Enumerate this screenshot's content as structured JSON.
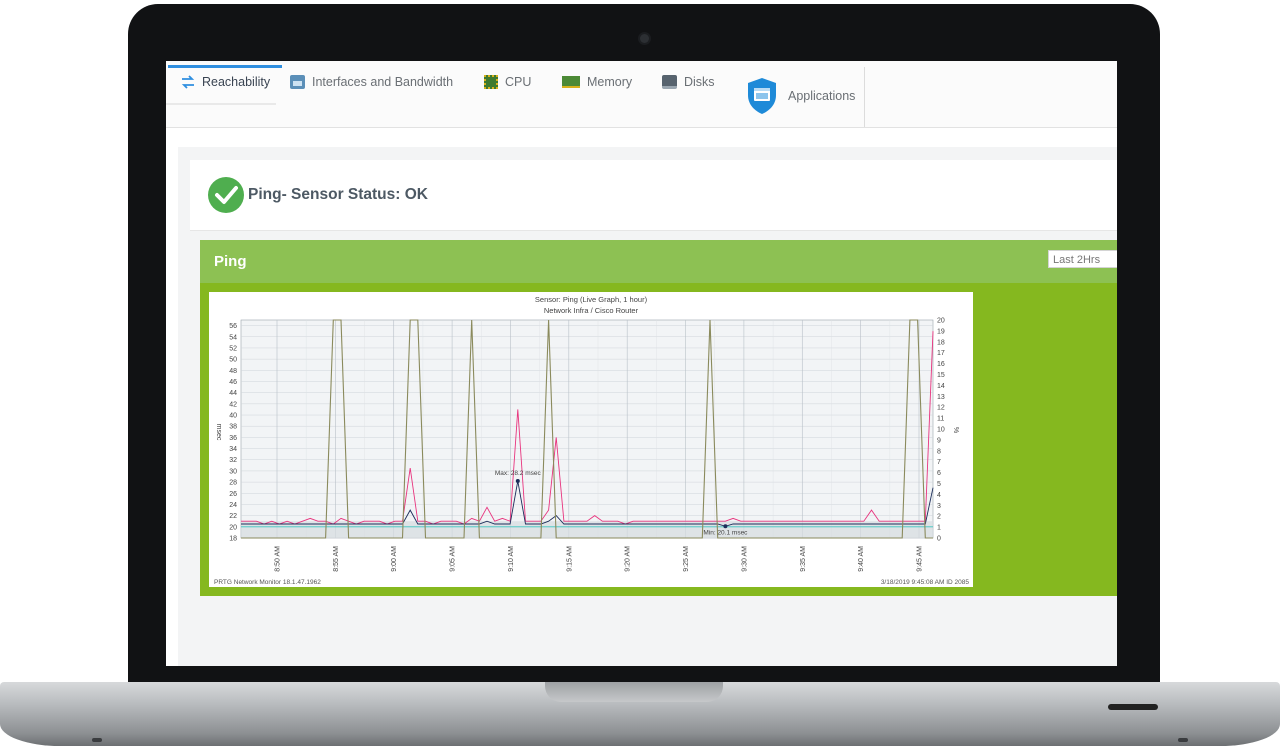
{
  "tabs": [
    {
      "label": "Reachability",
      "icon": "arrows-exchange-icon",
      "active": true
    },
    {
      "label": "Interfaces and Bandwidth",
      "icon": "network-interface-icon",
      "active": false
    },
    {
      "label": "CPU",
      "icon": "cpu-chip-icon",
      "active": false
    },
    {
      "label": "Memory",
      "icon": "memory-module-icon",
      "active": false
    },
    {
      "label": "Disks",
      "icon": "disk-drive-icon",
      "active": false
    },
    {
      "label": "Applications",
      "icon": "shield-window-icon",
      "active": false
    }
  ],
  "status": {
    "text": "Ping- Sensor Status: OK",
    "icon": "checkmark-circle-icon",
    "color": "#4fae4f"
  },
  "panel": {
    "title": "Ping",
    "range_label": "Last 2Hrs",
    "header_color": "#8dc153",
    "body_color": "#85b81f"
  },
  "chart_data": {
    "type": "line",
    "title": "Sensor: Ping (Live Graph, 1 hour)",
    "subtitle": "Network Infra / Cisco Router",
    "ylabel": "msec",
    "y2label": "%",
    "ylim": [
      18,
      57
    ],
    "y2lim": [
      0,
      20
    ],
    "yticks": [
      18,
      20,
      22,
      24,
      26,
      28,
      30,
      32,
      34,
      36,
      38,
      40,
      42,
      44,
      46,
      48,
      50,
      52,
      54,
      56
    ],
    "y2ticks": [
      0,
      1,
      2,
      3,
      4,
      5,
      6,
      7,
      8,
      9,
      10,
      11,
      12,
      13,
      14,
      15,
      16,
      17,
      18,
      19,
      20
    ],
    "y2tick_labels": [
      "0",
      "1",
      "2",
      "3",
      "4",
      "5",
      "6",
      "7",
      "8",
      "9",
      "10",
      "11",
      "12",
      "13",
      "14",
      "15",
      "16",
      "17",
      "18",
      "19",
      "20"
    ],
    "xticks": [
      "8:50 AM",
      "8:55 AM",
      "9:00 AM",
      "9:05 AM",
      "9:10 AM",
      "9:15 AM",
      "9:20 AM",
      "9:25 AM",
      "9:30 AM",
      "9:35 AM",
      "9:40 AM",
      "9:45 AM"
    ],
    "series": [
      {
        "name": "",
        "color": "#e8347e",
        "values": [
          21,
          21,
          21,
          20.5,
          21,
          20.5,
          21,
          20.5,
          21,
          21.5,
          21,
          21,
          20.5,
          21.5,
          21,
          20.5,
          21,
          21,
          21,
          20.5,
          21,
          21,
          30.5,
          21,
          21,
          20.5,
          21,
          21,
          21,
          20.5,
          21.5,
          21,
          23.5,
          21,
          21.5,
          21,
          41,
          21,
          21,
          21,
          23,
          36,
          21,
          21,
          21,
          21,
          22,
          21,
          21,
          21,
          20.5,
          21,
          21,
          21,
          21,
          21,
          21,
          21,
          21,
          21,
          21,
          21,
          21,
          21,
          21.5,
          21,
          21,
          21,
          21,
          21,
          21,
          21,
          21,
          21,
          21,
          21,
          21,
          21,
          21,
          21,
          21,
          21,
          23,
          21,
          21,
          21,
          21,
          21,
          21,
          21,
          55
        ]
      },
      {
        "name": "",
        "color": "#1c2d5a",
        "values": [
          20.5,
          20.5,
          20.5,
          20.5,
          20.5,
          20.5,
          20.5,
          20.5,
          20.5,
          20.5,
          20.5,
          20.5,
          20.5,
          20.5,
          20.5,
          20.5,
          20.5,
          20.5,
          20.5,
          20.5,
          20.5,
          20.5,
          23,
          20.5,
          20.5,
          20.5,
          20.5,
          20.5,
          20.5,
          20.5,
          20.5,
          20.5,
          21,
          20.5,
          20.5,
          20.5,
          28.2,
          20.5,
          20.5,
          20.5,
          21,
          22,
          20.5,
          20.5,
          20.5,
          20.5,
          20.5,
          20.5,
          20.5,
          20.5,
          20.5,
          20.5,
          20.5,
          20.5,
          20.5,
          20.5,
          20.5,
          20.5,
          20.5,
          20.5,
          20.5,
          20.5,
          20.5,
          20.1,
          20.5,
          20.5,
          20.5,
          20.5,
          20.5,
          20.5,
          20.5,
          20.5,
          20.5,
          20.5,
          20.5,
          20.5,
          20.5,
          20.5,
          20.5,
          20.5,
          20.5,
          20.5,
          20.5,
          20.5,
          20.5,
          20.5,
          20.5,
          20.5,
          20.5,
          20.5,
          27
        ]
      },
      {
        "name": "",
        "color": "#3cc6c0",
        "values": [
          20,
          20,
          20,
          20,
          20,
          20,
          20,
          20,
          20,
          20,
          20,
          20,
          20,
          20,
          20,
          20,
          20,
          20,
          20,
          20,
          20,
          20,
          20,
          20,
          20,
          20,
          20,
          20,
          20,
          20,
          20,
          20,
          20,
          20,
          20,
          20,
          20,
          20,
          20,
          20,
          20,
          20,
          20,
          20,
          20,
          20,
          20,
          20,
          20,
          20,
          20,
          20,
          20,
          20,
          20,
          20,
          20,
          20,
          20,
          20,
          20,
          20,
          20,
          20,
          20,
          20,
          20,
          20,
          20,
          20,
          20,
          20,
          20,
          20,
          20,
          20,
          20,
          20,
          20,
          20,
          20,
          20,
          20,
          20,
          20,
          20,
          20,
          20,
          20,
          20,
          20
        ]
      },
      {
        "name": "",
        "color": "#8a8a5c",
        "values": [
          0,
          0,
          0,
          0,
          0,
          0,
          0,
          0,
          0,
          0,
          0,
          0,
          20,
          20,
          0,
          0,
          0,
          0,
          0,
          0,
          0,
          0,
          20,
          20,
          0,
          0,
          0,
          0,
          0,
          0,
          20,
          0,
          0,
          0,
          0,
          0,
          0,
          0,
          0,
          0,
          20,
          0,
          0,
          0,
          0,
          0,
          0,
          0,
          0,
          0,
          0,
          0,
          0,
          0,
          0,
          0,
          0,
          0,
          0,
          0,
          0,
          20,
          0,
          0,
          0,
          0,
          0,
          0,
          0,
          0,
          0,
          0,
          0,
          0,
          0,
          0,
          0,
          0,
          0,
          0,
          0,
          0,
          0,
          0,
          0,
          0,
          0,
          20,
          20,
          0,
          0
        ]
      }
    ],
    "annotations": [
      {
        "text": "Max: 28.2 msec",
        "index": 36,
        "value": 28.2
      },
      {
        "text": "Min: 20.1 msec",
        "index": 63,
        "value": 20.1
      }
    ],
    "footer_left": "PRTG Network Monitor 18.1.47.1962",
    "footer_right": "3/18/2019 9:45:08 AM   ID 2085",
    "grid": true
  }
}
